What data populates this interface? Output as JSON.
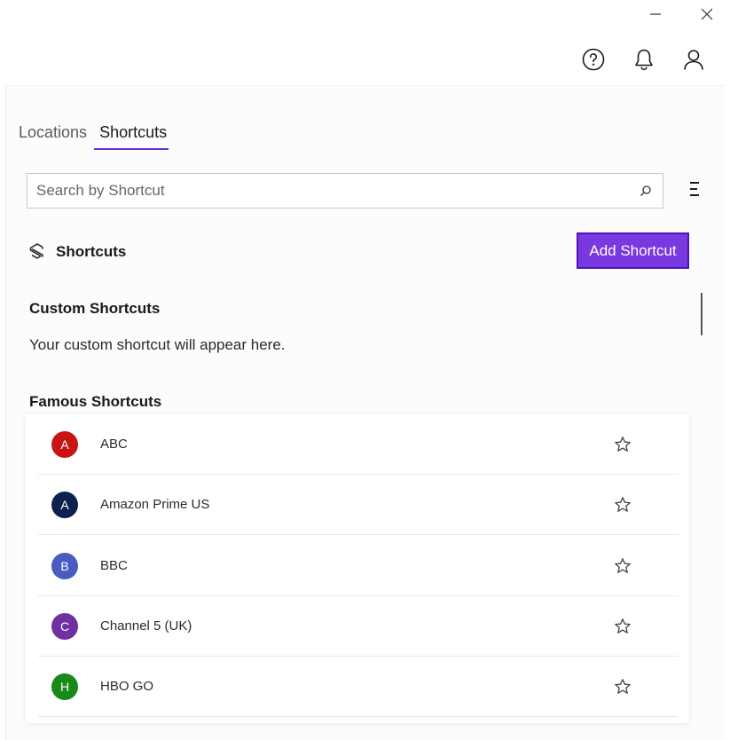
{
  "window": {
    "minimize_icon": "minimize-icon",
    "close_icon": "close-icon"
  },
  "topbar": {
    "icons": [
      "help-icon",
      "bell-icon",
      "user-icon"
    ]
  },
  "tabs": [
    {
      "label": "Locations",
      "active": false
    },
    {
      "label": "Shortcuts",
      "active": true
    }
  ],
  "search": {
    "placeholder": "Search by Shortcut",
    "value": ""
  },
  "section": {
    "title": "Shortcuts",
    "add_button": "Add Shortcut"
  },
  "custom": {
    "heading": "Custom Shortcuts",
    "empty_text": "Your custom shortcut will appear here."
  },
  "famous": {
    "heading": "Famous Shortcuts",
    "items": [
      {
        "initial": "A",
        "label": "ABC",
        "color": "#c81414"
      },
      {
        "initial": "A",
        "label": "Amazon Prime US",
        "color": "#0d2150"
      },
      {
        "initial": "B",
        "label": "BBC",
        "color": "#4a5bc2"
      },
      {
        "initial": "C",
        "label": "Channel 5 (UK)",
        "color": "#7030a0"
      },
      {
        "initial": "H",
        "label": "HBO GO",
        "color": "#178a17"
      }
    ]
  },
  "colors": {
    "accent": "#7a38e0",
    "accent_border": "#4a14b8"
  }
}
